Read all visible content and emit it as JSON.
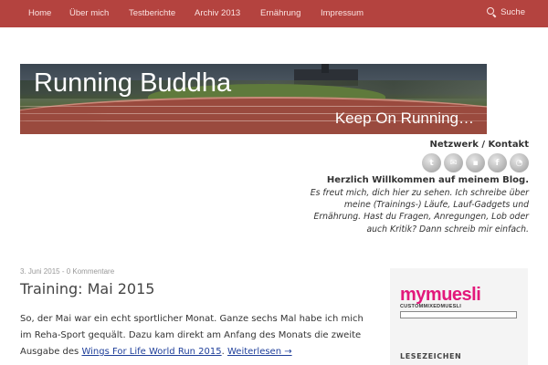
{
  "nav": {
    "items": [
      {
        "label": "Home"
      },
      {
        "label": "Über mich"
      },
      {
        "label": "Testberichte"
      },
      {
        "label": "Archiv 2013"
      },
      {
        "label": "Ernährung"
      },
      {
        "label": "Impressum"
      }
    ],
    "search_label": "Suche",
    "search_icon": "search-icon"
  },
  "banner": {
    "title": "Running Buddha",
    "tagline": "Keep On Running…"
  },
  "network": {
    "heading": "Netzwerk / Kontakt",
    "icons": [
      {
        "name": "twitter-icon",
        "glyph": "t"
      },
      {
        "name": "email-icon",
        "glyph": "✉"
      },
      {
        "name": "chat-icon",
        "glyph": "▪"
      },
      {
        "name": "facebook-icon",
        "glyph": "f"
      },
      {
        "name": "rss-icon",
        "glyph": "◔"
      }
    ]
  },
  "welcome": {
    "title": "Herzlich Willkommen auf meinem Blog.",
    "text": "Es freut mich, dich hier zu sehen. Ich schreibe über meine (Trainings-) Läufe, Lauf-Gadgets und Ernährung. Hast du Fragen, Anregungen, Lob oder auch Kritik? Dann schreib mir einfach."
  },
  "post": {
    "date": "3. Juni 2015",
    "separator": " - ",
    "comments": "0 Kommentare",
    "title": "Training: Mai 2015",
    "body_text": "So, der Mai war ein echt sportlicher Monat. Ganze sechs Mal habe ich mich im Reha-Sport gequält. Dazu kam direkt am Anfang des Monats die zweite Ausgabe des",
    "link_text": "Wings For Life World Run 2015",
    "trailing": ".",
    "read_more": "Weiterlesen →"
  },
  "sidebar": {
    "ad_brand_my": "my",
    "ad_brand_muesli": "muesli",
    "ad_sub": "CUSTOMMIXEDMUESLI",
    "heading": "LESEZEICHEN"
  },
  "colors": {
    "nav_bg": "#b4433f",
    "link": "#1f3f9a",
    "brand_pink": "#e2187b"
  }
}
